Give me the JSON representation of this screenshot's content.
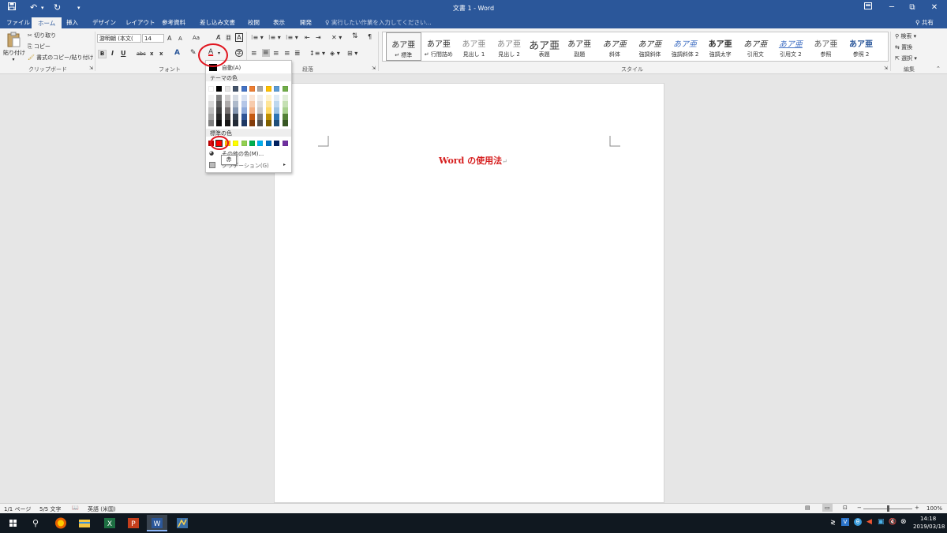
{
  "titlebar": {
    "title": "文書 1 - Word",
    "save_icon": "save-icon",
    "undo_icon": "undo-icon",
    "redo_icon": "redo-icon",
    "qa_more": "▾",
    "ribbon_toggle": "ribbon-display-icon",
    "minimize": "─",
    "restore": "⧉",
    "close": "✕"
  },
  "tabs": [
    "ファイル",
    "ホーム",
    "挿入",
    "デザイン",
    "レイアウト",
    "参考資料",
    "差し込み文書",
    "校閲",
    "表示",
    "開発"
  ],
  "tellme": "実行したい作業を入力してください...",
  "share": "共有",
  "clipboard": {
    "paste": "貼り付け",
    "cut": "切り取り",
    "copy": "コピー",
    "format_painter": "書式のコピー/貼り付け",
    "label": "クリップボード"
  },
  "font": {
    "name": "游明朝 (本文(",
    "size": "14",
    "grow": "A",
    "shrink": "A",
    "case": "Aa",
    "bold": "B",
    "italic": "I",
    "underline": "U",
    "strike": "abc",
    "sub": "x",
    "sup": "x",
    "label": "フォント"
  },
  "paragraph": {
    "label": "段落"
  },
  "styles": {
    "label": "スタイル",
    "items": [
      {
        "sample": "あア亜",
        "name": "標準"
      },
      {
        "sample": "あア亜",
        "name": "行間詰め"
      },
      {
        "sample": "あア亜",
        "name": "見出し 1"
      },
      {
        "sample": "あア亜",
        "name": "見出し 2"
      },
      {
        "sample": "あア亜",
        "name": "表題"
      },
      {
        "sample": "あア亜",
        "name": "副題"
      },
      {
        "sample": "あア亜",
        "name": "斜体"
      },
      {
        "sample": "あア亜",
        "name": "強調斜体"
      },
      {
        "sample": "あア亜",
        "name": "強調斜体 2"
      },
      {
        "sample": "あア亜",
        "name": "強調太字"
      },
      {
        "sample": "あア亜",
        "name": "引用文"
      },
      {
        "sample": "あア亜",
        "name": "引用文 2"
      },
      {
        "sample": "あア亜",
        "name": "参照"
      },
      {
        "sample": "あア亜",
        "name": "参照 2"
      }
    ]
  },
  "editing": {
    "find": "検索",
    "replace": "置換",
    "select": "選択",
    "label": "編集"
  },
  "colorpicker": {
    "auto": "自動(A)",
    "theme_label": "テーマの色",
    "standard_label": "標準の色",
    "more": "その他の色(M)...",
    "gradient": "グラデーション(G)",
    "tooltip": "赤",
    "theme_top": [
      "#ffffff",
      "#000000",
      "#e7e6e6",
      "#44546a",
      "#4472c4",
      "#ed7d31",
      "#a5a5a5",
      "#ffc000",
      "#5b9bd5",
      "#70ad47"
    ],
    "theme_shades": [
      [
        "#f2f2f2",
        "#7f7f7f",
        "#d0cece",
        "#d6dce4",
        "#d9e2f3",
        "#fbe5d5",
        "#ededed",
        "#fff2cc",
        "#deebf6",
        "#e2efd9"
      ],
      [
        "#d8d8d8",
        "#595959",
        "#aeabab",
        "#adb9ca",
        "#b4c6e7",
        "#f7cbac",
        "#dbdbdb",
        "#fee599",
        "#bdd7ee",
        "#c5e0b3"
      ],
      [
        "#bfbfbf",
        "#3f3f3f",
        "#757070",
        "#8496b0",
        "#8eaadb",
        "#f4b083",
        "#c9c9c9",
        "#ffd965",
        "#9cc3e5",
        "#a8d08d"
      ],
      [
        "#a5a5a5",
        "#262626",
        "#3a3838",
        "#323f4f",
        "#2f5496",
        "#c55a11",
        "#7b7b7b",
        "#bf8f00",
        "#2e75b5",
        "#538135"
      ],
      [
        "#7f7f7f",
        "#0c0c0c",
        "#171616",
        "#222a35",
        "#1e3864",
        "#833c0b",
        "#525252",
        "#7f6000",
        "#1e4e79",
        "#375623"
      ]
    ],
    "standard": [
      "#c00000",
      "#ff0000",
      "#ffc000",
      "#ffff00",
      "#92d050",
      "#00b050",
      "#00b0f0",
      "#0070c0",
      "#002060",
      "#7030a0"
    ]
  },
  "document": {
    "text": "Word の使用法",
    "mark": "↵"
  },
  "status": {
    "page": "1/1 ページ",
    "words": "5/5 文字",
    "lang": "英語 (米国)",
    "zoom": "100%",
    "minus": "−",
    "plus": "+"
  },
  "taskbar": {
    "time": "14:18",
    "date": "2019/03/18"
  },
  "icons": {
    "start": "windows-start-icon",
    "search": "search-icon",
    "firefox": "firefox-icon",
    "explorer": "file-explorer-icon",
    "excel": "excel-icon",
    "powerpoint": "powerpoint-icon",
    "word": "word-icon",
    "app": "app-icon"
  },
  "colors": {
    "accent": "#2b579a",
    "highlight_red": "#e0141e",
    "doc_text": "#d61e1e"
  }
}
